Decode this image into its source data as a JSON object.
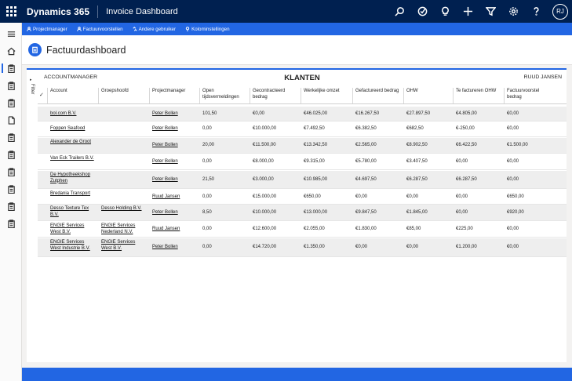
{
  "app": {
    "name": "Dynamics 365",
    "area": "Invoice Dashboard",
    "user_initials": "RJ"
  },
  "topbar_icons": [
    "search-icon",
    "task-icon",
    "lightbulb-icon",
    "plus-icon",
    "filter-icon",
    "gear-icon",
    "help-icon"
  ],
  "commands": [
    {
      "label": "Projectmanager",
      "icon": "person-icon"
    },
    {
      "label": "Factuurvoorstellen",
      "icon": "person-icon"
    },
    {
      "label": "Andere gebruiker",
      "icon": "swap-icon"
    },
    {
      "label": "Kolominstellingen",
      "icon": "bulb-icon"
    }
  ],
  "page": {
    "title": "Factuurdashboard"
  },
  "filter": {
    "label": "Filter"
  },
  "report": {
    "left_label": "ACCOUNTMANAGER",
    "title": "KLANTEN",
    "right_label": "RUUD JANSEN",
    "columns": [
      "Account",
      "Groepshoofd",
      "Projectmanager",
      "Open tijdsvermeldingen",
      "Gecontracteerd bedrag",
      "Werkelijke omzet",
      "Gefactureerd bedrag",
      "OHW",
      "Te factureren OHW",
      "Factuurvoorstel bedrag"
    ],
    "rows": [
      {
        "account": "bol.com B.V.",
        "group": "",
        "pm": "Peter Bollen",
        "open": "101,50",
        "contract": "€0,00",
        "revenue": "€46.025,00",
        "invoiced": "€16.267,50",
        "ohw": "€27.897,50",
        "to_invoice": "€4.805,00",
        "proposal": "€0,00"
      },
      {
        "account": "Foppen Seafood",
        "group": "",
        "pm": "Peter Bollen",
        "open": "0,00",
        "contract": "€10.000,00",
        "revenue": "€7.492,50",
        "invoiced": "€6.382,50",
        "ohw": "€682,50",
        "to_invoice": "€-250,00",
        "proposal": "€0,00"
      },
      {
        "account": "Alexander de Groot",
        "group": "",
        "pm": "Peter Bollen",
        "open": "20,00",
        "contract": "€11.500,00",
        "revenue": "€13.342,50",
        "invoiced": "€2.565,00",
        "ohw": "€8.902,50",
        "to_invoice": "€6.422,50",
        "proposal": "€1.500,00"
      },
      {
        "account": "Van Eck Trailers B.V.",
        "group": "",
        "pm": "Peter Bollen",
        "open": "0,00",
        "contract": "€8.000,00",
        "revenue": "€9.315,00",
        "invoiced": "€5.780,00",
        "ohw": "€3.407,50",
        "to_invoice": "€0,00",
        "proposal": "€0,00"
      },
      {
        "account": "De Hypotheekshop Zutphen",
        "group": "",
        "pm": "Peter Bollen",
        "open": "21,50",
        "contract": "€3.000,00",
        "revenue": "€10.985,00",
        "invoiced": "€4.697,50",
        "ohw": "€6.287,50",
        "to_invoice": "€6.287,50",
        "proposal": "€0,00"
      },
      {
        "account": "Bredania Transport",
        "group": "",
        "pm": "Ruud Jansen",
        "open": "0,00",
        "contract": "€15.000,00",
        "revenue": "€650,00",
        "invoiced": "€0,00",
        "ohw": "€0,00",
        "to_invoice": "€0,00",
        "proposal": "€650,00"
      },
      {
        "account": "Desso Texture Tex B.V.",
        "group": "Desso Holding B.V.",
        "pm": "Peter Bollen",
        "open": "8,50",
        "contract": "€10.000,00",
        "revenue": "€13.000,00",
        "invoiced": "€9.847,50",
        "ohw": "€1.845,00",
        "to_invoice": "€0,00",
        "proposal": "€920,00"
      },
      {
        "account": "ENGIE Services West B.V.",
        "group": "ENGIE Services Nederland N.V.",
        "pm": "Ruud Jansen",
        "open": "0,00",
        "contract": "€12.600,00",
        "revenue": "€2.055,00",
        "invoiced": "€1.830,00",
        "ohw": "€85,00",
        "to_invoice": "€225,00",
        "proposal": "€0,00"
      },
      {
        "account": "ENGIE Services West Industrie B.V.",
        "group": "ENGIE Services West B.V.",
        "pm": "Peter Bollen",
        "open": "0,00",
        "contract": "€14.720,00",
        "revenue": "€1.350,00",
        "invoiced": "€0,00",
        "ohw": "€0,00",
        "to_invoice": "€1.200,00",
        "proposal": "€0,00"
      }
    ]
  },
  "colors": {
    "header_bg": "#002050",
    "accent": "#2266e3"
  }
}
